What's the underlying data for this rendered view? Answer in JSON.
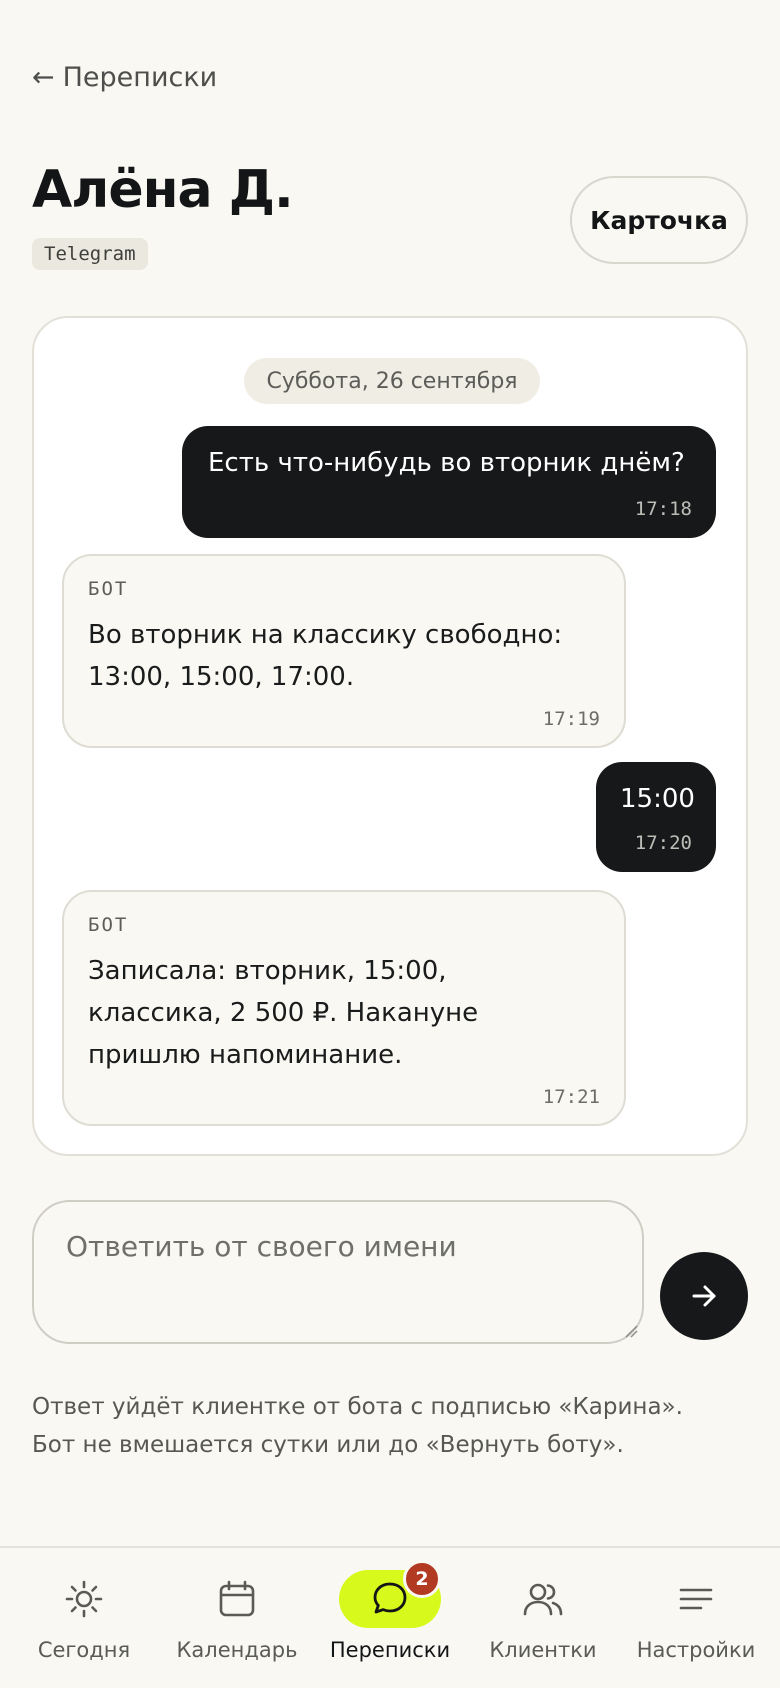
{
  "header": {
    "back_label": "Переписки",
    "contact_name": "Алёна Д.",
    "channel": "Telegram",
    "card_button": "Карточка"
  },
  "chat": {
    "date_label": "Суббота, 26 сентября",
    "messages": [
      {
        "from": "client",
        "text": "Есть что-нибудь во вторник днём?",
        "time": "17:18"
      },
      {
        "from": "bot",
        "sender": "БОТ",
        "lines": [
          "Во вторник на классику свободно:",
          "13:00, 15:00, 17:00."
        ],
        "time": "17:19"
      },
      {
        "from": "client",
        "text": "15:00",
        "time": "17:20"
      },
      {
        "from": "bot",
        "sender": "БОТ",
        "lines": [
          "Записала: вторник, 15:00,",
          "классика, 2 500 ₽. Накануне",
          "пришлю напоминание."
        ],
        "time": "17:21"
      }
    ]
  },
  "composer": {
    "placeholder": "Ответить от своего имени",
    "value": "",
    "send_icon": "arrow-right-icon"
  },
  "hint": {
    "line1": "Ответ уйдёт клиентке от бота с подписью «Карина».",
    "line2": "Бот не вмешается сутки или до «Вернуть боту»."
  },
  "nav": {
    "items": [
      {
        "label": "Сегодня",
        "icon": "sun-icon"
      },
      {
        "label": "Календарь",
        "icon": "calendar-icon"
      },
      {
        "label": "Переписки",
        "icon": "chat-bubble-icon",
        "active": true,
        "badge": "2"
      },
      {
        "label": "Клиентки",
        "icon": "users-icon"
      },
      {
        "label": "Настройки",
        "icon": "menu-lines-icon"
      }
    ]
  },
  "colors": {
    "background": "#f9f8f3",
    "accent": "#d8f91c",
    "dark": "#171819",
    "badge": "#b23a23"
  }
}
